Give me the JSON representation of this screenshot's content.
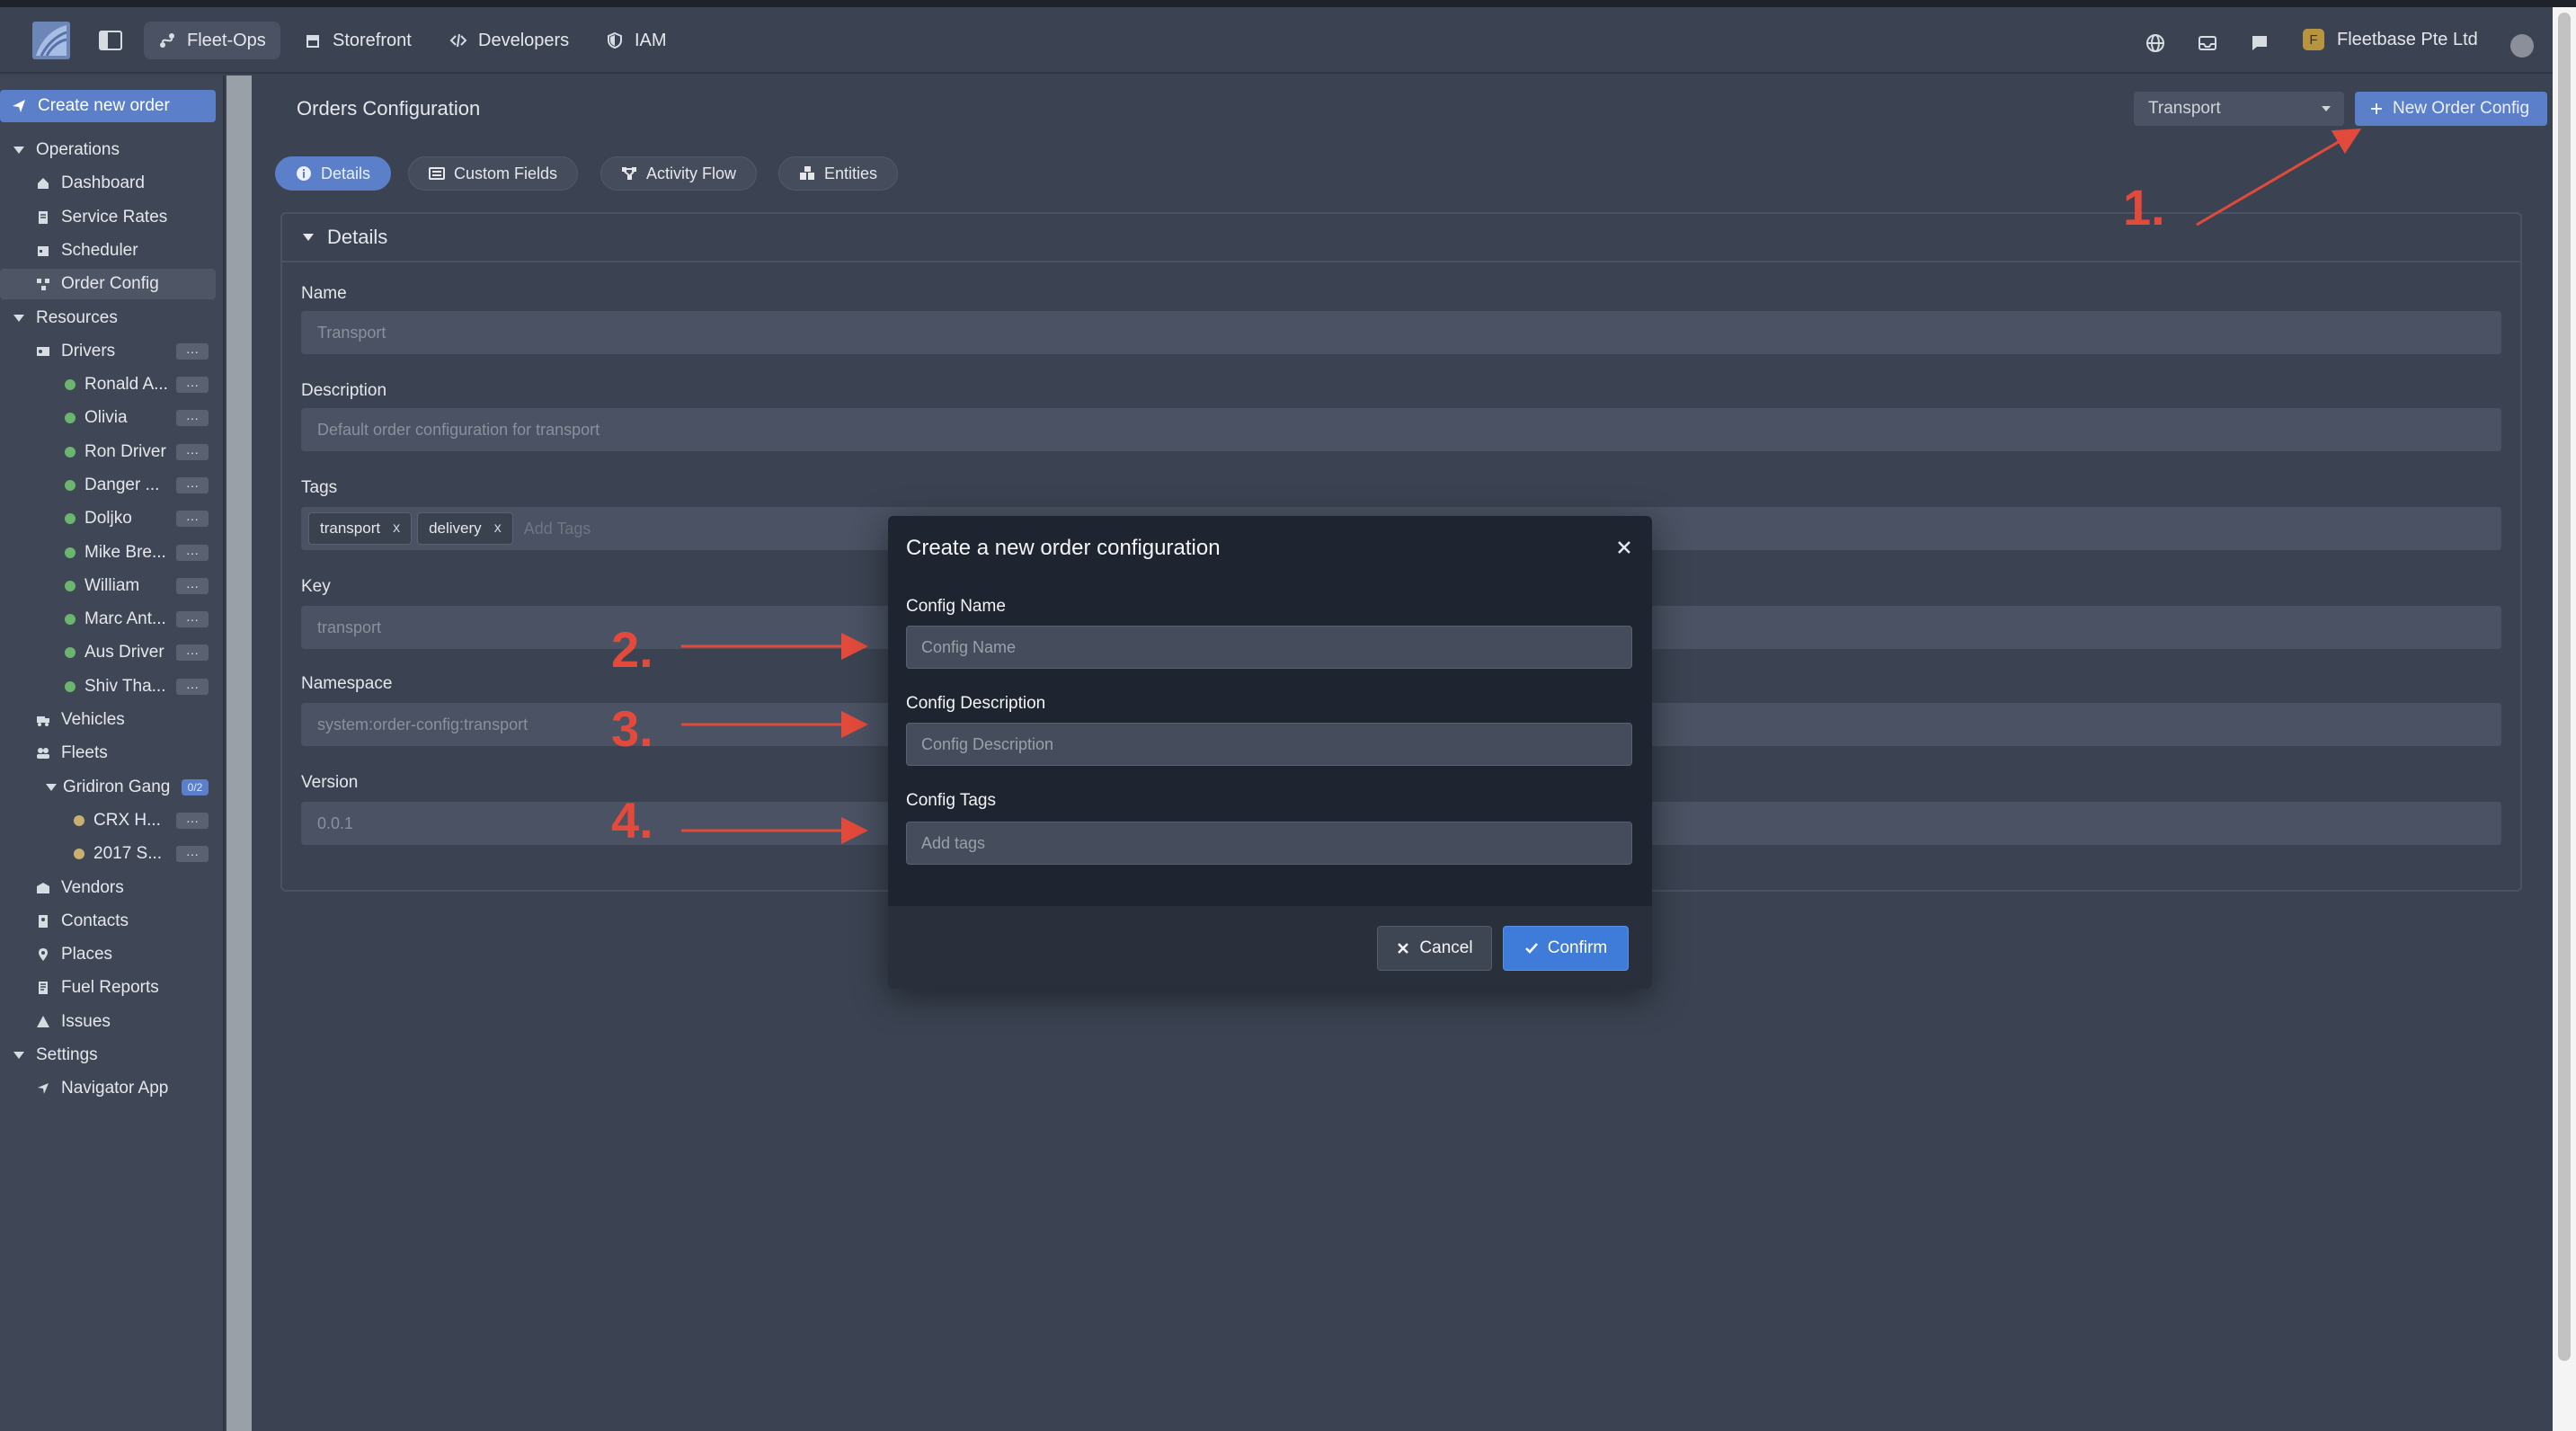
{
  "header": {
    "tabs": [
      {
        "label": "Fleet-Ops",
        "icon": "route-icon",
        "active": true
      },
      {
        "label": "Storefront",
        "icon": "store-icon",
        "active": false
      },
      {
        "label": "Developers",
        "icon": "code-icon",
        "active": false
      },
      {
        "label": "IAM",
        "icon": "shield-icon",
        "active": false
      }
    ],
    "org_name": "Fleetbase Pte Ltd",
    "org_initial": "F"
  },
  "sidebar": {
    "create_label": "Create new order",
    "sections": {
      "operations": "Operations",
      "resources": "Resources",
      "settings": "Settings"
    },
    "operations": [
      "Dashboard",
      "Service Rates",
      "Scheduler",
      "Order Config"
    ],
    "drivers_label": "Drivers",
    "drivers": [
      "Ronald A...",
      "Olivia",
      "Ron Driver",
      "Danger ...",
      "Doljko",
      "Mike Bre...",
      "William",
      "Marc Ant...",
      "Aus Driver",
      "Shiv Tha..."
    ],
    "vehicles": "Vehicles",
    "fleets": "Fleets",
    "fleet_group": "Gridiron Gang",
    "fleet_group_count": "0/2",
    "fleet_members": [
      "CRX H...",
      "2017 S..."
    ],
    "other": [
      "Vendors",
      "Contacts",
      "Places",
      "Fuel Reports",
      "Issues"
    ],
    "settings_items": [
      "Navigator App"
    ],
    "more_glyph": "···"
  },
  "main": {
    "title": "Orders Configuration",
    "config_select": "Transport",
    "new_config_label": "New Order Config",
    "tabs": [
      "Details",
      "Custom Fields",
      "Activity Flow",
      "Entities"
    ],
    "panel_title": "Details",
    "fields": {
      "name_label": "Name",
      "name_value": "Transport",
      "description_label": "Description",
      "description_value": "Default order configuration for transport",
      "tags_label": "Tags",
      "tags": [
        "transport",
        "delivery"
      ],
      "tags_placeholder": "Add Tags",
      "key_label": "Key",
      "key_value": "transport",
      "namespace_label": "Namespace",
      "namespace_value": "system:order-config:transport",
      "version_label": "Version",
      "version_value": "0.0.1"
    }
  },
  "annotations": [
    "1.",
    "2.",
    "3.",
    "4."
  ],
  "modal": {
    "title": "Create a new order configuration",
    "name_label": "Config Name",
    "name_placeholder": "Config Name",
    "description_label": "Config Description",
    "description_placeholder": "Config Description",
    "tags_label": "Config Tags",
    "tags_placeholder": "Add tags",
    "cancel_label": "Cancel",
    "confirm_label": "Confirm"
  },
  "colors": {
    "accent": "#5b80c9",
    "confirm": "#3f7bd9",
    "annotation": "#e24a3b",
    "driver_online": "#6bb56e"
  }
}
